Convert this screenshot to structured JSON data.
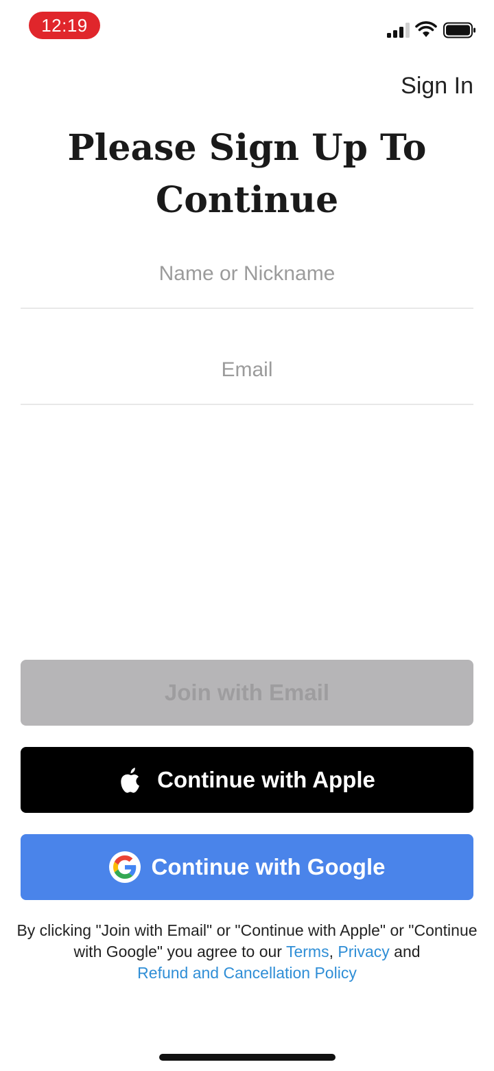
{
  "status_bar": {
    "time": "12:19"
  },
  "header": {
    "sign_in_label": "Sign In"
  },
  "title": {
    "line1": "Please Sign Up To",
    "line2": "Continue"
  },
  "form": {
    "name_placeholder": "Name or Nickname",
    "name_value": "",
    "email_placeholder": "Email",
    "email_value": ""
  },
  "buttons": {
    "join_email_label": "Join with Email",
    "apple_label": "Continue with Apple",
    "google_label": "Continue with Google"
  },
  "legal": {
    "text_prefix": "By clicking \"Join with Email\" or \"Continue with Apple\" or \"Continue with Google\" you agree to our ",
    "terms_label": "Terms",
    "separator": ", ",
    "privacy_label": "Privacy",
    "and_text": " and ",
    "refund_label": "Refund and Cancellation Policy"
  },
  "colors": {
    "time_pill": "#e0262b",
    "join_disabled_bg": "#b6b5b7",
    "apple_bg": "#000000",
    "google_bg": "#4a84ea",
    "link": "#2f8ed6"
  },
  "icons": [
    "signal-icon",
    "wifi-icon",
    "battery-icon",
    "apple-icon",
    "google-icon"
  ]
}
